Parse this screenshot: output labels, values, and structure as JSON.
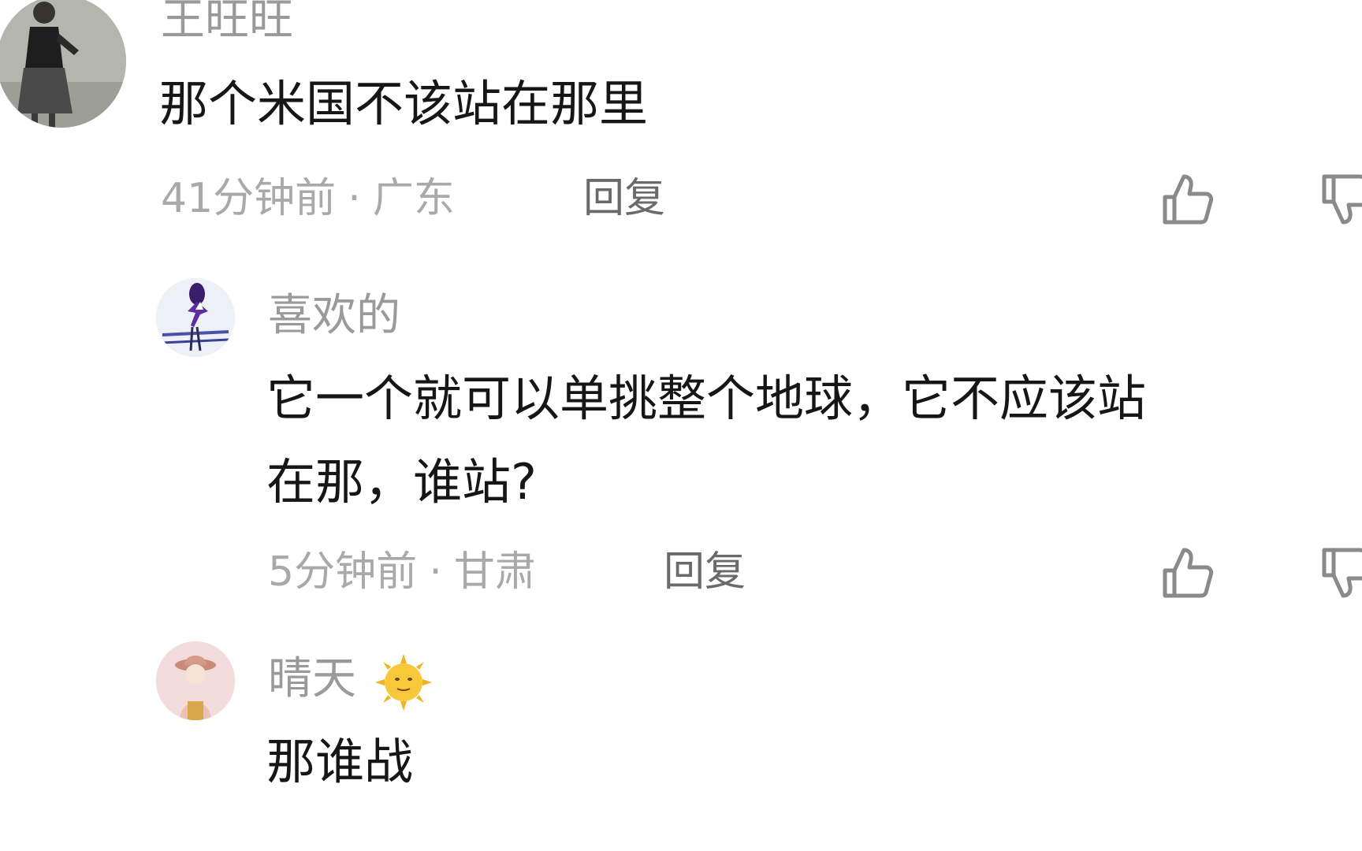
{
  "comments": [
    {
      "username": "王旺旺",
      "text": "那个米国不该站在那里",
      "time": "41分钟前",
      "separator": "·",
      "location": "广东",
      "reply_label": "回复",
      "avatar_icon": "person-photo-avatar",
      "like_icon": "thumbs-up-icon",
      "dislike_icon": "thumbs-down-icon"
    },
    {
      "username": "喜欢的",
      "text": "它一个就可以单挑整个地球，它不应该站在那，谁站?",
      "text_line1": "它一个就可以单挑整个地球，它不应该站",
      "text_line2": "在那，谁站?",
      "time": "5分钟前",
      "separator": "·",
      "location": "甘肃",
      "reply_label": "回复",
      "avatar_icon": "dancer-avatar",
      "like_icon": "thumbs-up-icon",
      "dislike_icon": "thumbs-down-icon"
    },
    {
      "username": "晴天",
      "username_emoji": "sun-face-emoji",
      "text": "那谁战",
      "avatar_icon": "child-hat-avatar"
    }
  ],
  "colors": {
    "background": "#ffffff",
    "text_primary": "#161616",
    "text_secondary": "#a9a9a9",
    "reply_text": "#6a6a6a",
    "emoji_sun": "#f5c531"
  }
}
